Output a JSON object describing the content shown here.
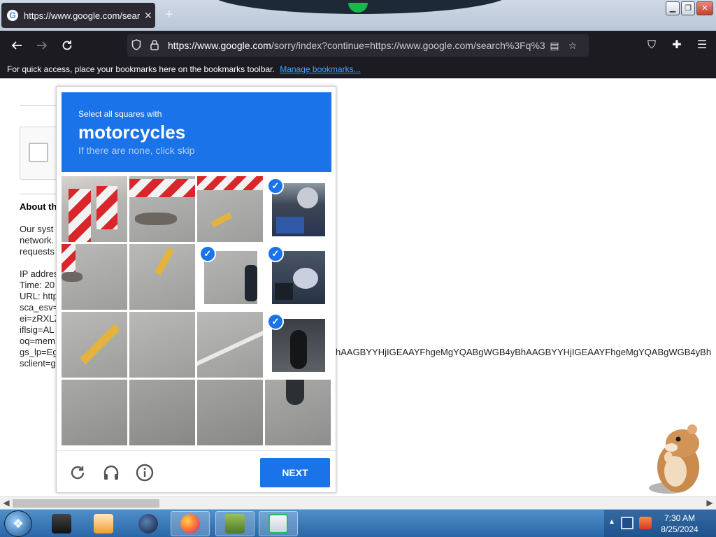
{
  "browser": {
    "tab_title": "https://www.google.com/search",
    "tab_favicon": "google-favicon",
    "url_host": "https://www.google.com",
    "url_rest": "/sorry/index?continue=https://www.google.com/search%3Fq%3",
    "bookmarks_text": "For quick access, place your bookmarks here on the bookmarks toolbar.",
    "bookmarks_link": "Manage bookmarks..."
  },
  "page": {
    "about_heading": "About th",
    "para_lines": [
      "Our syst",
      "network.",
      "requests",
      "",
      "IP addres",
      "Time: 20",
      "URL: http",
      "sca_esv=",
      "ei=zRXLZ",
      "iflsig=AL",
      "oq=mem",
      "gs_lp=Eg",
      "sclient=g"
    ],
    "gs_lp_tail": "hAAGBYYHjIGEAAYFhgeMgYQABgWGB4yBhAAGBYYHjIGEAAYFhgeMgYQABgWGB4yBh"
  },
  "captcha": {
    "instruction": "Select all squares with",
    "target": "motorcycles",
    "hint": "If there are none, click skip",
    "next_label": "NEXT",
    "accent_color": "#1a73e8",
    "selected_tiles": [
      "r1c4",
      "r2c3",
      "r2c4",
      "r3c4"
    ],
    "check_mark": "✓"
  },
  "taskbar": {
    "time": "7:30 AM",
    "date": "8/25/2024"
  }
}
